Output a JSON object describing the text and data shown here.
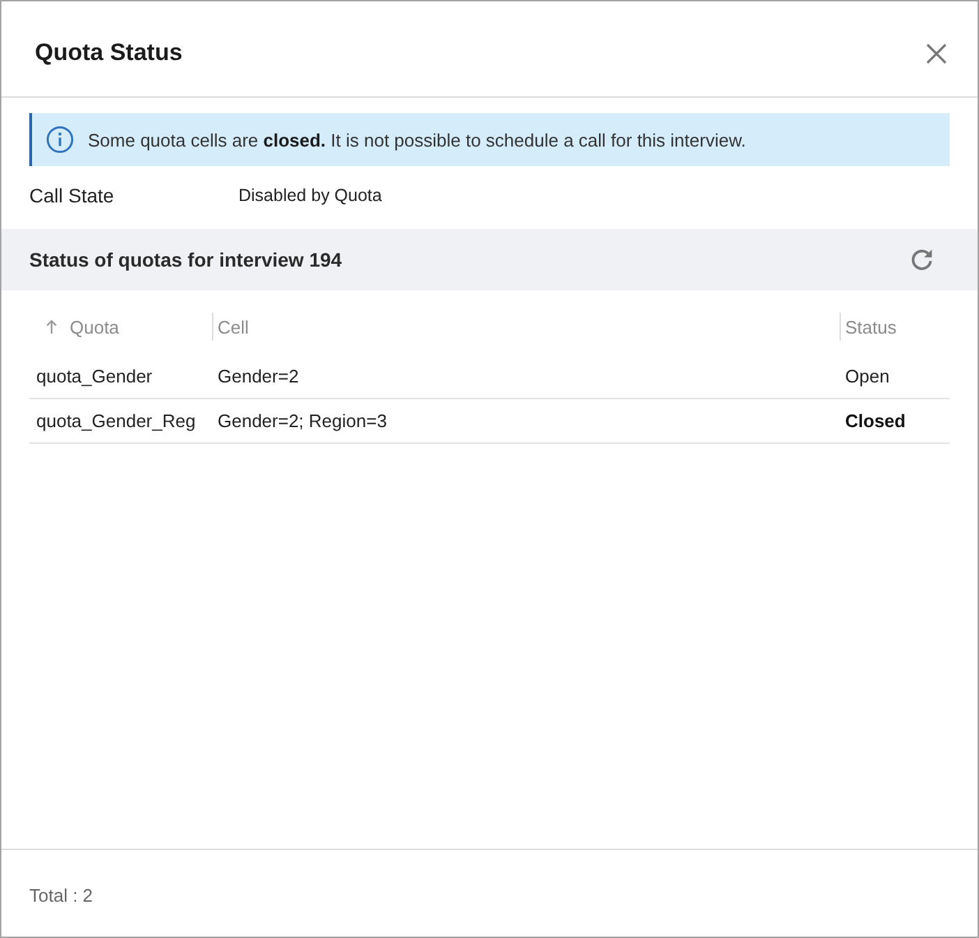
{
  "dialog": {
    "title": "Quota Status"
  },
  "info_banner": {
    "text": "Some quota cells are **closed.** It is not possible to schedule a call for this interview."
  },
  "call_state": {
    "label": "Call State",
    "value": "Disabled by Quota"
  },
  "section": {
    "title": "Status of quotas for interview 194"
  },
  "table": {
    "columns": [
      {
        "label": "Quota",
        "sorted": true
      },
      {
        "label": "Cell",
        "sorted": false
      },
      {
        "label": "Status",
        "sorted": false
      }
    ],
    "rows": [
      {
        "quota": "quota_Gender",
        "cell": "Gender=2",
        "status": "Open",
        "closed": false
      },
      {
        "quota": "quota_Gender_Reg",
        "cell": "Gender=2; Region=3",
        "status": "Closed",
        "closed": true
      }
    ]
  },
  "footer": {
    "total": "Total : 2"
  }
}
